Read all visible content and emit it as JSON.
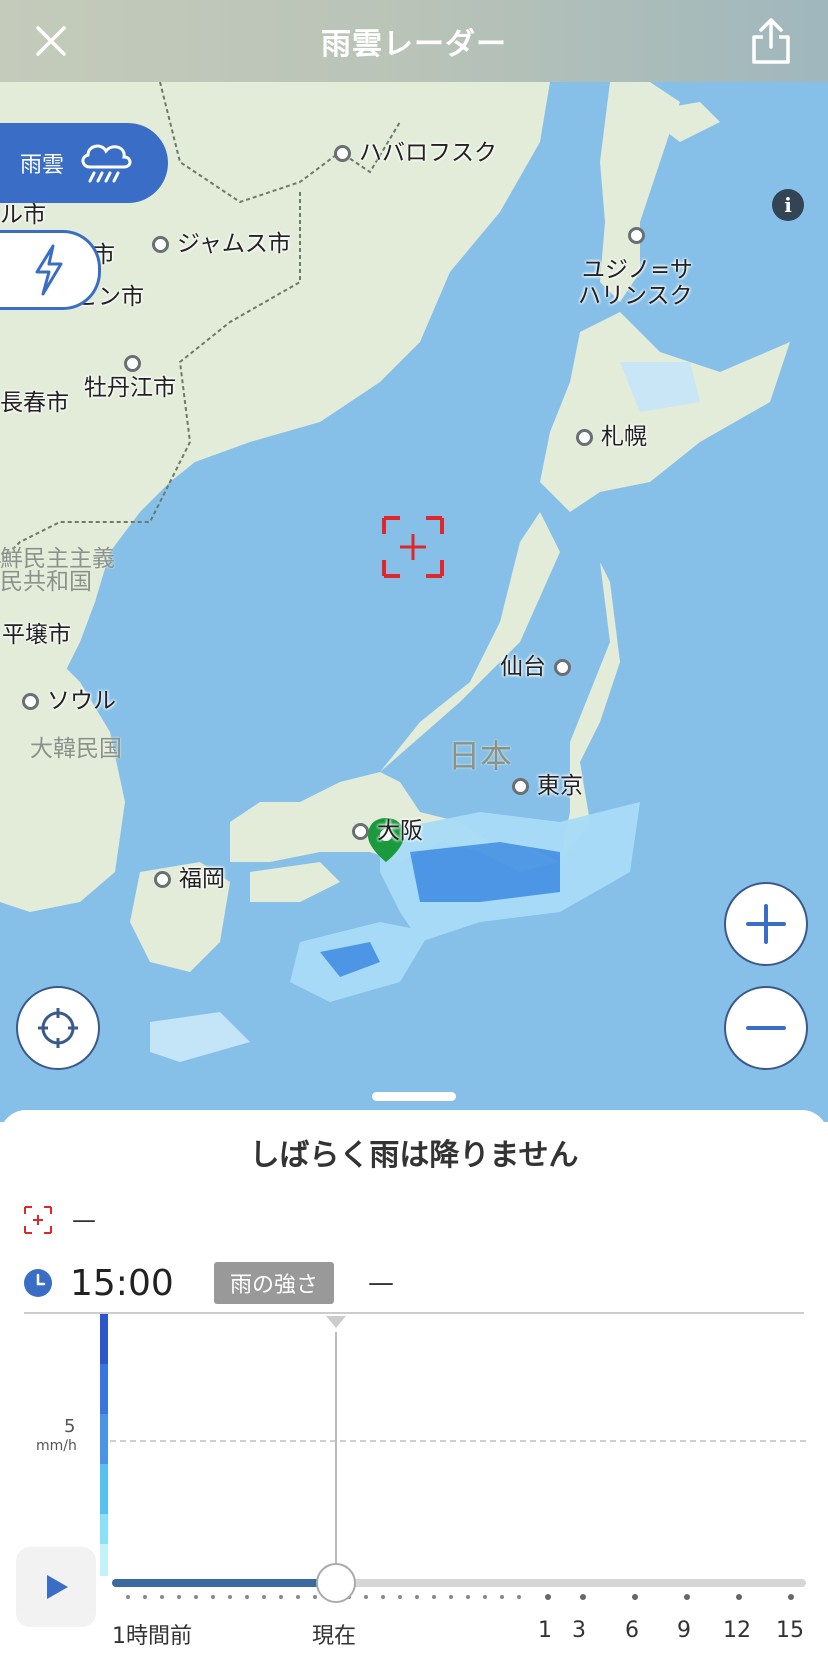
{
  "header": {
    "title": "雨雲レーダー",
    "close_icon": "close-icon",
    "share_icon": "share-icon"
  },
  "map": {
    "layer_label": "雨雲",
    "zoom_in_label": "+",
    "zoom_out_label": "−",
    "info_label": "i",
    "region_labels": {
      "japan": "日本",
      "north_korea_1": "鮮民主主義",
      "north_korea_2": "民共和国",
      "korea": "大韓民国"
    },
    "cities": {
      "khabarovsk": "ハバロフスク",
      "jiamusi": "ジャムス市",
      "harbin": "ハルビン市",
      "mudanjiang": "牡丹江市",
      "changchun": "長春市",
      "yuzhno_1": "ユジノ=サ",
      "yuzhno_2": "ハリンスク",
      "sapporo": "札幌",
      "sendai": "仙台",
      "tokyo": "東京",
      "osaka": "大阪",
      "fukuoka": "福岡",
      "pyongyang": "平壌市",
      "seoul": "ソウル",
      "partial_1": "ル市",
      "partial_2": "市"
    },
    "colors": {
      "sea": "#86c0e8",
      "land": "#e3ebd9",
      "rain_light": "#a9dcf7",
      "rain_medium": "#4a94e6",
      "accent": "#3a6ec6"
    }
  },
  "sheet": {
    "title": "しばらく雨は降りません",
    "location_value": "—",
    "time": "15:00",
    "intensity_badge": "雨の強さ",
    "intensity_value": "—",
    "y_value": "5",
    "y_unit": "mm/h",
    "timeline_ticks": [
      "1時間前",
      "現在",
      "1",
      "3",
      "6",
      "9",
      "12",
      "15"
    ]
  }
}
